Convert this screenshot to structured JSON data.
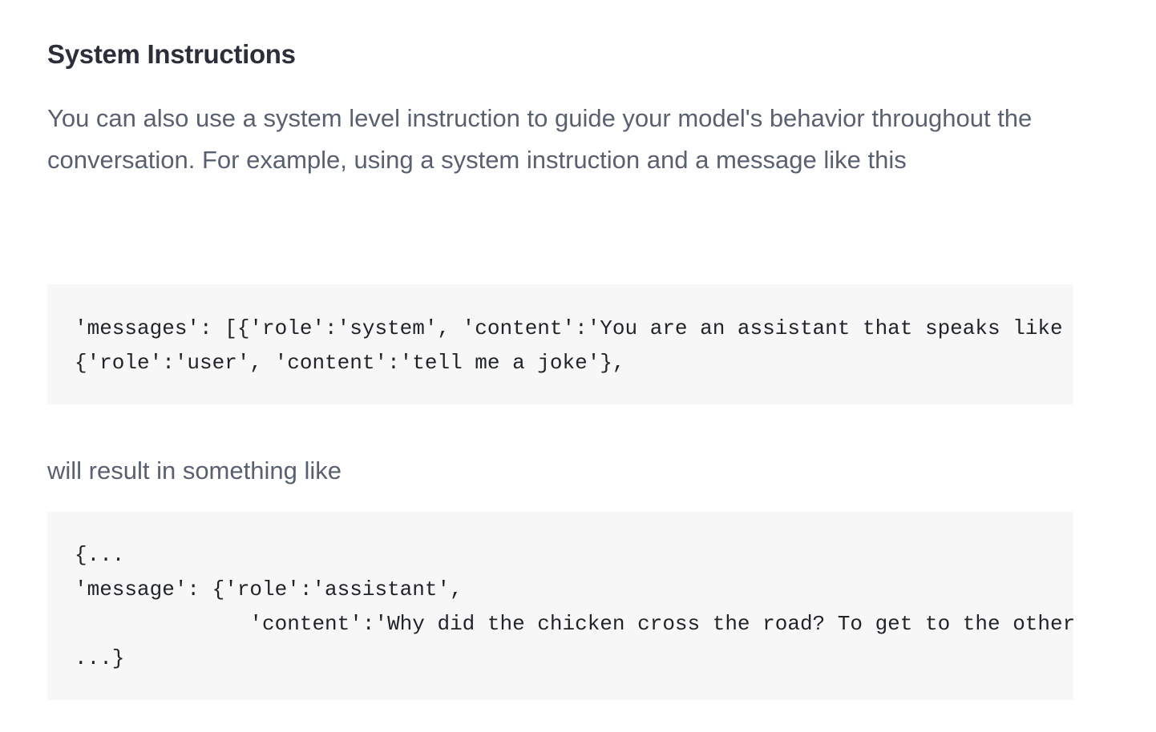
{
  "section": {
    "title": "System Instructions",
    "intro": "You can also use a system level instruction to guide your model's behavior throughout the conversation. For example, using a system instruction and a message like this",
    "result_intro": "will result in something like"
  },
  "code_request": {
    "lines": [
      "'messages': [{'role':'system', 'content':'You are an assistant that speaks like",
      "{'role':'user', 'content':'tell me a joke'},"
    ]
  },
  "code_response": {
    "lines": [
      "{...",
      "'message': {'role':'assistant',",
      "              'content':'Why did the chicken cross the road? To get to the other",
      "...}"
    ]
  }
}
